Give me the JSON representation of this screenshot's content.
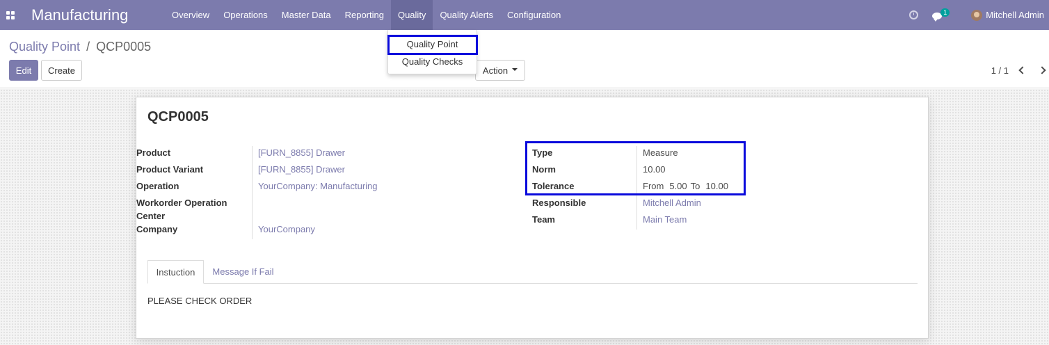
{
  "navbar": {
    "app_title": "Manufacturing",
    "menu": [
      "Overview",
      "Operations",
      "Master Data",
      "Reporting",
      "Quality",
      "Quality Alerts",
      "Configuration"
    ],
    "active_menu": "Quality",
    "chat_count": "1",
    "user_name": "Mitchell Admin",
    "icons": [
      "apps-grid-icon",
      "clock-icon",
      "chat-icon",
      "avatar"
    ]
  },
  "breadcrumb": {
    "parent": "Quality Point",
    "separator": "/",
    "current": "QCP0005"
  },
  "buttons": {
    "edit": "Edit",
    "create": "Create",
    "action": "Action"
  },
  "pager": {
    "value": "1 / 1"
  },
  "dropdown": {
    "items": [
      "Quality Point",
      "Quality Checks"
    ]
  },
  "record": {
    "title": "QCP0005",
    "left_fields": [
      {
        "label": "Product",
        "value": "[FURN_8855] Drawer"
      },
      {
        "label": "Product Variant",
        "value": "[FURN_8855] Drawer"
      },
      {
        "label": "Operation",
        "value": "YourCompany: Manufacturing"
      },
      {
        "label": "Workorder Operation",
        "label_line2": "Center",
        "value": ""
      },
      {
        "label": "Company",
        "value": "YourCompany"
      }
    ],
    "right_fields": {
      "type": {
        "label": "Type",
        "value": "Measure"
      },
      "norm": {
        "label": "Norm",
        "value": "10.00"
      },
      "tolerance": {
        "label": "Tolerance",
        "from_label": "From",
        "from_value": "5.00",
        "to_label": "To",
        "to_value": "10.00"
      },
      "responsible": {
        "label": "Responsible",
        "value": "Mitchell Admin"
      },
      "team": {
        "label": "Team",
        "value": "Main Team"
      }
    }
  },
  "tabs": [
    {
      "label": "Instuction",
      "active": true
    },
    {
      "label": "Message If Fail",
      "active": false
    }
  ],
  "tab_content": "PLEASE CHECK ORDER",
  "colors": {
    "navbar": "#7c7bad",
    "active_menu": "#6a6a9c",
    "link": "#7c7bad",
    "highlight": "#0a0adc",
    "badge": "#00a09d"
  }
}
